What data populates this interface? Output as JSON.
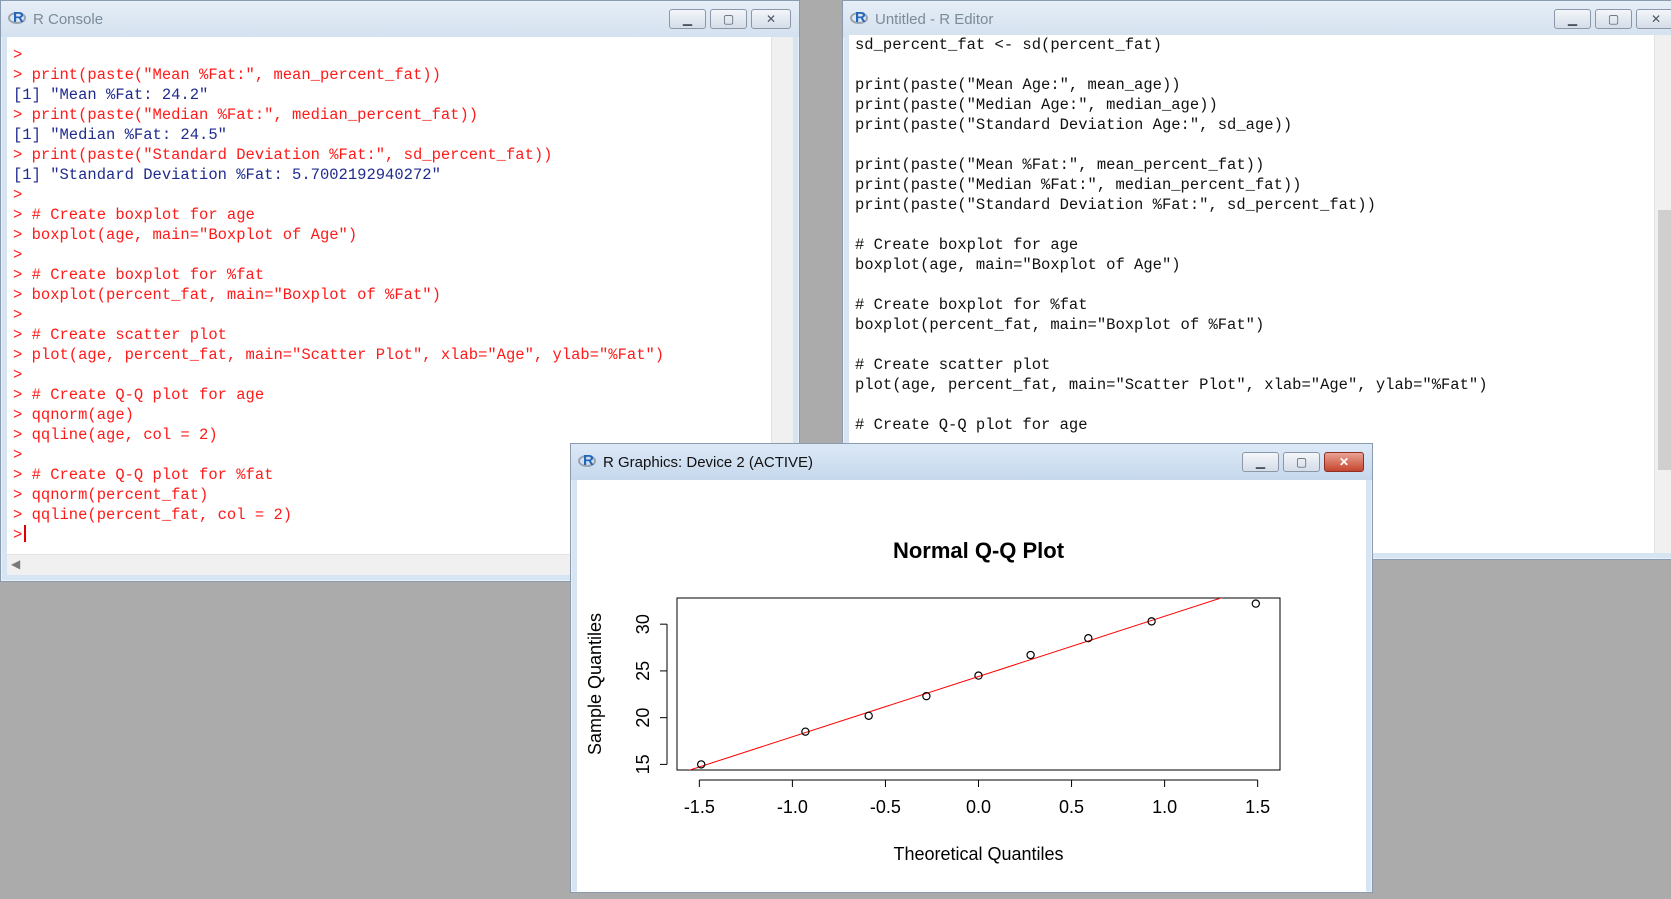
{
  "console": {
    "title": "R Console",
    "lines": [
      {
        "t": ">",
        "k": "cmd"
      },
      {
        "t": "> print(paste(\"Mean %Fat:\", mean_percent_fat))",
        "k": "cmd"
      },
      {
        "t": "[1] \"Mean %Fat: 24.2\"",
        "k": "out"
      },
      {
        "t": "> print(paste(\"Median %Fat:\", median_percent_fat))",
        "k": "cmd"
      },
      {
        "t": "[1] \"Median %Fat: 24.5\"",
        "k": "out"
      },
      {
        "t": "> print(paste(\"Standard Deviation %Fat:\", sd_percent_fat))",
        "k": "cmd"
      },
      {
        "t": "[1] \"Standard Deviation %Fat: 5.7002192940272\"",
        "k": "out"
      },
      {
        "t": ">",
        "k": "cmd"
      },
      {
        "t": "> # Create boxplot for age",
        "k": "cmd"
      },
      {
        "t": "> boxplot(age, main=\"Boxplot of Age\")",
        "k": "cmd"
      },
      {
        "t": ">",
        "k": "cmd"
      },
      {
        "t": "> # Create boxplot for %fat",
        "k": "cmd"
      },
      {
        "t": "> boxplot(percent_fat, main=\"Boxplot of %Fat\")",
        "k": "cmd"
      },
      {
        "t": ">",
        "k": "cmd"
      },
      {
        "t": "> # Create scatter plot",
        "k": "cmd"
      },
      {
        "t": "> plot(age, percent_fat, main=\"Scatter Plot\", xlab=\"Age\", ylab=\"%Fat\")",
        "k": "cmd"
      },
      {
        "t": ">",
        "k": "cmd"
      },
      {
        "t": "> # Create Q-Q plot for age",
        "k": "cmd"
      },
      {
        "t": "> qqnorm(age)",
        "k": "cmd"
      },
      {
        "t": "> qqline(age, col = 2)",
        "k": "cmd"
      },
      {
        "t": ">",
        "k": "cmd"
      },
      {
        "t": "> # Create Q-Q plot for %fat",
        "k": "cmd"
      },
      {
        "t": "> qqnorm(percent_fat)",
        "k": "cmd"
      },
      {
        "t": "> qqline(percent_fat, col = 2)",
        "k": "cmd"
      }
    ],
    "prompt": ">"
  },
  "editor": {
    "title": "Untitled - R Editor",
    "lines": [
      "sd_percent_fat <- sd(percent_fat)",
      "",
      "print(paste(\"Mean Age:\", mean_age))",
      "print(paste(\"Median Age:\", median_age))",
      "print(paste(\"Standard Deviation Age:\", sd_age))",
      "",
      "print(paste(\"Mean %Fat:\", mean_percent_fat))",
      "print(paste(\"Median %Fat:\", median_percent_fat))",
      "print(paste(\"Standard Deviation %Fat:\", sd_percent_fat))",
      "",
      "# Create boxplot for age",
      "boxplot(age, main=\"Boxplot of Age\")",
      "",
      "# Create boxplot for %fat",
      "boxplot(percent_fat, main=\"Boxplot of %Fat\")",
      "",
      "# Create scatter plot",
      "plot(age, percent_fat, main=\"Scatter Plot\", xlab=\"Age\", ylab=\"%Fat\")",
      "",
      "# Create Q-Q plot for age"
    ]
  },
  "graphics": {
    "title": "R Graphics: Device 2 (ACTIVE)"
  },
  "chart_data": {
    "type": "scatter",
    "title": "Normal Q-Q Plot",
    "xlabel": "Theoretical Quantiles",
    "ylabel": "Sample Quantiles",
    "xlim": [
      -1.62,
      1.62
    ],
    "ylim": [
      14.4,
      32.8
    ],
    "xticks": [
      -1.5,
      -1.0,
      -0.5,
      0.0,
      0.5,
      1.0,
      1.5
    ],
    "xtick_labels": [
      "-1.5",
      "-1.0",
      "-0.5",
      "0.0",
      "0.5",
      "1.0",
      "1.5"
    ],
    "yticks": [
      15,
      20,
      25,
      30
    ],
    "ytick_labels": [
      "15",
      "20",
      "25",
      "30"
    ],
    "points": [
      {
        "x": -1.49,
        "y": 15.0
      },
      {
        "x": -0.93,
        "y": 18.5
      },
      {
        "x": -0.59,
        "y": 20.2
      },
      {
        "x": -0.28,
        "y": 22.3
      },
      {
        "x": 0.0,
        "y": 24.5
      },
      {
        "x": 0.28,
        "y": 26.7
      },
      {
        "x": 0.59,
        "y": 28.5
      },
      {
        "x": 0.93,
        "y": 30.3
      },
      {
        "x": 1.49,
        "y": 32.2
      }
    ],
    "qqline": {
      "intercept": 24.4,
      "slope": 6.45,
      "color": "#ff0000"
    },
    "grid": false
  }
}
